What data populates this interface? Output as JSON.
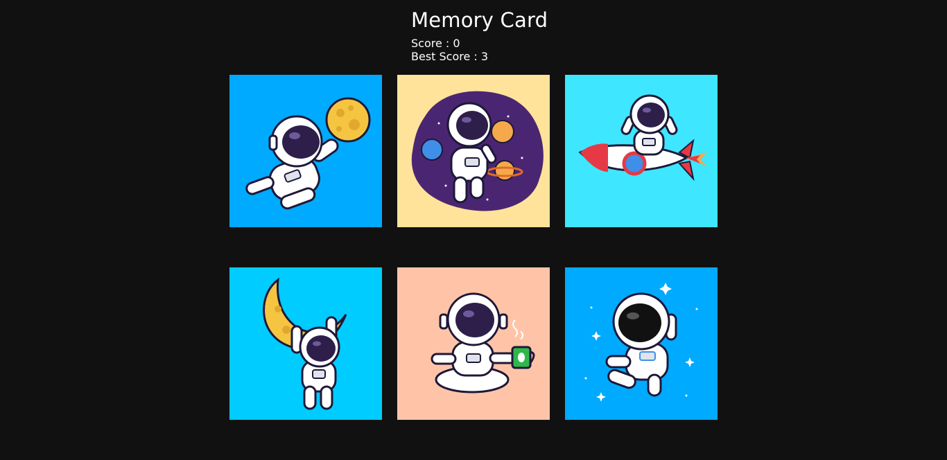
{
  "game": {
    "title": "Memory Card",
    "score_label": "Score : 0",
    "best_score_label": "Best Score : 3",
    "score": 0,
    "best_score": 3
  },
  "cards": [
    {
      "name": "astronaut-reaching-moon",
      "bg": "#00aaff"
    },
    {
      "name": "astronaut-in-galaxy-planets",
      "bg": "#ffe39a"
    },
    {
      "name": "astronaut-riding-rocket",
      "bg": "#3ee6ff"
    },
    {
      "name": "astronaut-hanging-on-moon",
      "bg": "#00ccff"
    },
    {
      "name": "astronaut-meditating-coffee",
      "bg": "#ffc4a8"
    },
    {
      "name": "astronaut-floating-stars",
      "bg": "#00aaff"
    }
  ],
  "colors": {
    "page_bg": "#111111",
    "text": "#ffffff",
    "visor": "#2d1f4a",
    "suit": "#ffffff",
    "outline": "#1e1838",
    "moon": "#f5c542",
    "galaxy": "#4a2672",
    "planet_blue": "#3f8fe8",
    "planet_orange": "#f5a94a",
    "rocket_red": "#e63946",
    "mug_green": "#2fb84a"
  }
}
